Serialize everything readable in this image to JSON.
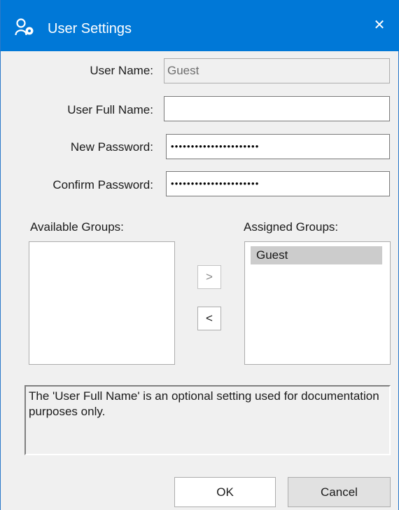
{
  "window": {
    "title": "User Settings",
    "close_glyph": "✕"
  },
  "form": {
    "user_name_label": "User Name:",
    "user_name_value": "Guest",
    "full_name_label": "User Full Name:",
    "full_name_value": "",
    "new_password_label": "New Password:",
    "new_password_value": "••••••••••••••••••••••",
    "confirm_password_label": "Confirm Password:",
    "confirm_password_value": "••••••••••••••••••••••"
  },
  "groups": {
    "available_label": "Available Groups:",
    "assigned_label": "Assigned Groups:",
    "assigned_items": [
      "Guest"
    ],
    "add_glyph": ">",
    "remove_glyph": "<"
  },
  "info": {
    "text": "The 'User Full Name' is an optional setting used for documentation purposes only."
  },
  "buttons": {
    "ok_label": "OK",
    "cancel_label": "Cancel"
  },
  "icons": {
    "title_icon": "user-settings-icon"
  },
  "colors": {
    "titlebar": "#0078d7"
  }
}
